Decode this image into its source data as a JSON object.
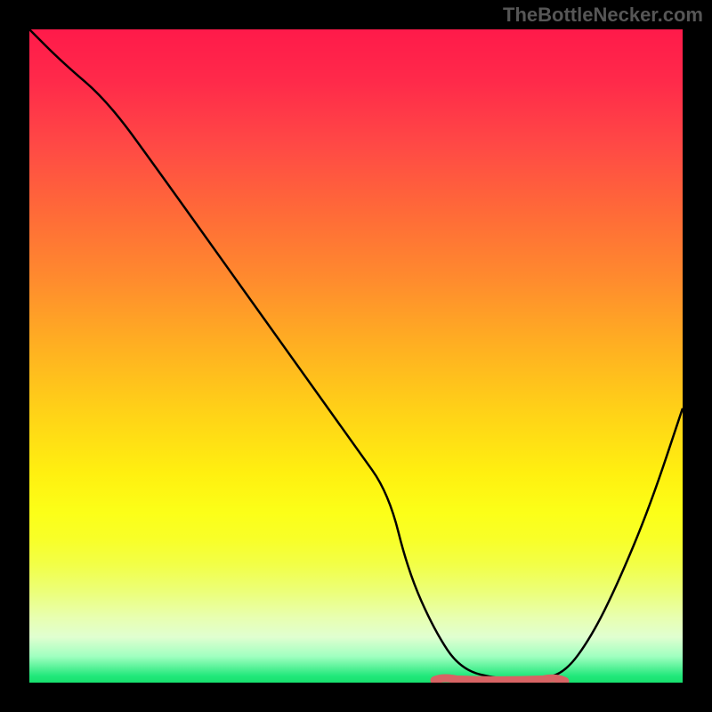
{
  "attribution": "TheBottleNecker.com",
  "chart_data": {
    "type": "line",
    "title": "",
    "xlabel": "",
    "ylabel": "",
    "xlim": [
      0,
      100
    ],
    "ylim": [
      0,
      100
    ],
    "series": [
      {
        "name": "curve",
        "x": [
          0,
          5,
          12,
          20,
          30,
          40,
          50,
          55,
          58,
          62,
          66,
          72,
          78,
          82,
          86,
          90,
          95,
          100
        ],
        "values": [
          100,
          95,
          89,
          78,
          64,
          50,
          36,
          29,
          17,
          8,
          2,
          0.5,
          0.5,
          1.5,
          7,
          15,
          27,
          42
        ]
      }
    ],
    "bottom_band": {
      "x_start": 62,
      "x_end": 82,
      "y": 0.5
    },
    "gradient_stops": [
      {
        "pos": 0,
        "color": "#ff1a4a"
      },
      {
        "pos": 50,
        "color": "#ffc820"
      },
      {
        "pos": 78,
        "color": "#fcff18"
      },
      {
        "pos": 100,
        "color": "#18e06e"
      }
    ]
  }
}
